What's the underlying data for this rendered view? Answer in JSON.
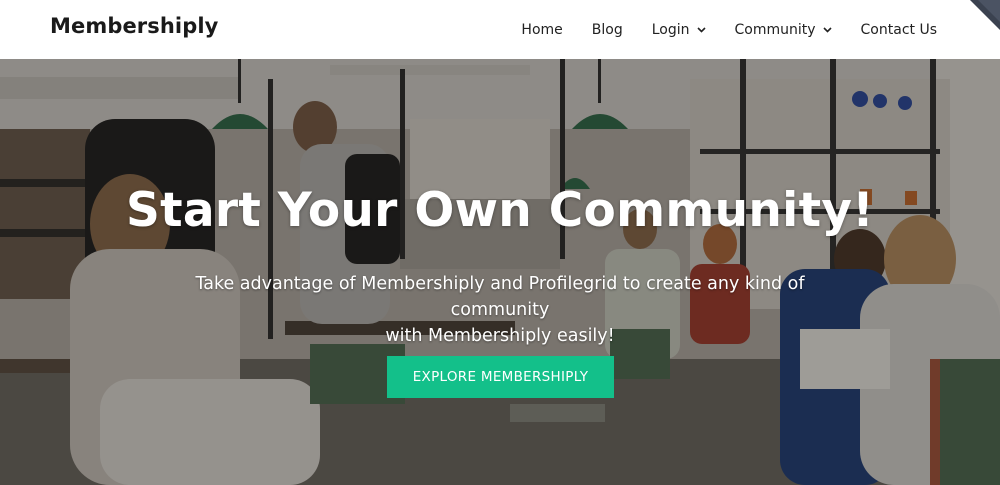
{
  "site": {
    "logo": "Membershiply"
  },
  "nav": {
    "items": [
      {
        "label": "Home",
        "has_dropdown": false
      },
      {
        "label": "Blog",
        "has_dropdown": false
      },
      {
        "label": "Login",
        "has_dropdown": true
      },
      {
        "label": "Community",
        "has_dropdown": true
      },
      {
        "label": "Contact Us",
        "has_dropdown": false
      }
    ]
  },
  "hero": {
    "title": "Start Your Own Community!",
    "subtitle_line1": "Take advantage of Membershiply and Profilegrid to create any kind of community",
    "subtitle_line2": "with Membershiply easily!",
    "cta_label": "EXPLORE MEMBERSHIPLY",
    "background": "cafe-photo",
    "cta_color": "#13c08a"
  },
  "icons": {
    "dropdown": "chevron-down-icon",
    "corner": "corner-ribbon-icon"
  }
}
